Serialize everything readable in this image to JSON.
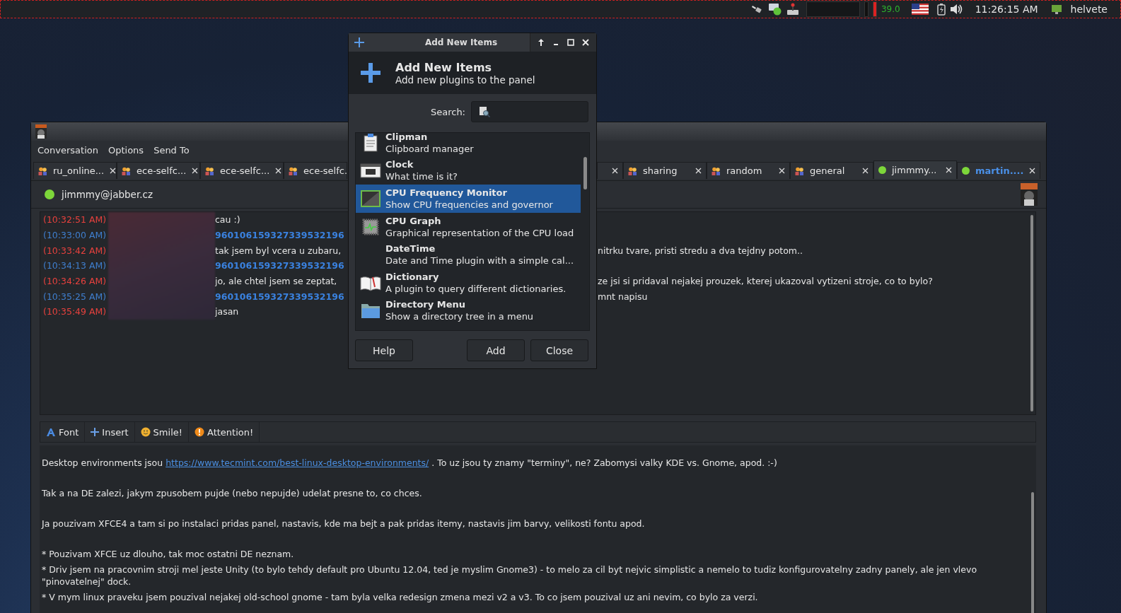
{
  "top_panel": {
    "cpu_reading": "39.0",
    "clock": "11:26:15 AM",
    "user": "helvete"
  },
  "chat_window": {
    "menu": [
      "Conversation",
      "Options",
      "Send To"
    ],
    "tabs_left": [
      {
        "kind": "group",
        "label": "ru_online...",
        "selected": false,
        "unread": false,
        "close": true
      },
      {
        "kind": "group",
        "label": "ece-selfc...",
        "selected": false,
        "unread": false,
        "close": true
      },
      {
        "kind": "group",
        "label": "ece-selfc...",
        "selected": false,
        "unread": false,
        "close": true
      },
      {
        "kind": "group",
        "label": "ece-selfc.",
        "selected": false,
        "unread": false
      }
    ],
    "tabs_right": [
      {
        "kind": "partial",
        "selected": false,
        "close": true
      },
      {
        "kind": "group",
        "label": "sharing",
        "selected": false,
        "unread": false,
        "close": true
      },
      {
        "kind": "group",
        "label": "random",
        "selected": false,
        "unread": false,
        "close": true
      },
      {
        "kind": "group",
        "label": "general",
        "selected": false,
        "unread": false,
        "close": true
      },
      {
        "kind": "contact",
        "label": "jimmmy...",
        "selected": true,
        "unread": false,
        "close": true
      },
      {
        "kind": "contact",
        "label": "martin....",
        "selected": false,
        "unread": true,
        "close": true
      }
    ],
    "contact": {
      "name": "jimmmy@jabber.cz",
      "online": true
    },
    "messages": [
      {
        "outgoing": false,
        "time": "(10:32:51 AM)",
        "text": "cau :)"
      },
      {
        "outgoing": true,
        "time": "(10:33:00 AM)",
        "text": "960106159327339532196"
      },
      {
        "outgoing": false,
        "time": "(10:33:42 AM)",
        "text": "tak jsem byl vcera u zubaru,",
        "text_right": "nitrku tvare, pristi stredu a dva tejdny potom.."
      },
      {
        "outgoing": true,
        "time": "(10:34:13 AM)",
        "text": "960106159327339532196"
      },
      {
        "outgoing": false,
        "time": "(10:34:26 AM)",
        "text": "jo, ale chtel jsem se zeptat,",
        "text_right": "ze jsi si pridaval nejakej prouzek, kterej ukazoval vytizeni stroje, co to bylo?"
      },
      {
        "outgoing": true,
        "time": "(10:35:25 AM)",
        "text": "960106159327339532196",
        "text_right": "mnt napisu"
      },
      {
        "outgoing": false,
        "time": "(10:35:49 AM)",
        "text": "jasan"
      }
    ],
    "toolbar": [
      "Font",
      "Insert",
      "Smile!",
      "Attention!"
    ],
    "input_paragraphs": [
      {
        "kind": "link",
        "before": "Desktop environments jsou",
        "link": "https://www.tecmint.com/best-linux-desktop-environments/",
        "after": ". To uz jsou ty znamy \"terminy\", ne? Zabomysi valky KDE vs. Gnome, apod. :-)"
      },
      {
        "kind": "paragraph",
        "text": "Tak a na DE zalezi, jakym zpusobem pujde (nebo nepujde) udelat presne to, co chces."
      },
      {
        "kind": "paragraph",
        "text": "Ja pouzivam XFCE4 a tam si po instalaci pridas panel, nastavis, kde ma bejt a pak pridas itemy, nastavis jim barvy, velikosti fontu apod."
      },
      {
        "kind": "bullet",
        "text": "* Pouzivam XFCE uz dlouho, tak moc ostatni DE neznam."
      },
      {
        "kind": "bullet",
        "text": "* Driv jsem na pracovnim stroji mel jeste Unity (to bylo tehdy default pro Ubuntu 12.04, ted je myslim Gnome3) - to melo za cil byt nejvic simplistic a nemelo to tudiz konfigurovatelny zadny panely, ale jen vlevo \"pinovatelnej\" dock."
      },
      {
        "kind": "bullet",
        "text": "* V mym linux praveku jsem pouzival nejakej old-school gnome - tam byla velka redesign zmena mezi v2 a v3. To co jsem pouzival uz ani nevim, co bylo za verzi."
      }
    ]
  },
  "dialog": {
    "title": "Add New Items",
    "heading": "Add New Items",
    "subtitle": "Add new plugins to the panel",
    "search_label": "Search:",
    "items": [
      {
        "title": "Clipman",
        "description": "Clipboard manager",
        "selected": false
      },
      {
        "title": "Clock",
        "description": "What time is it?",
        "selected": false
      },
      {
        "title": "CPU Frequency Monitor",
        "description": "Show CPU frequencies and governor",
        "selected": true
      },
      {
        "title": "CPU Graph",
        "description": "Graphical representation of the CPU load",
        "selected": false
      },
      {
        "title": "DateTime",
        "description": "Date and Time plugin with a simple cal...",
        "selected": false
      },
      {
        "title": "Dictionary",
        "description": "A plugin to query different dictionaries.",
        "selected": false
      },
      {
        "title": "Directory Menu",
        "description": "Show a directory tree in a menu",
        "selected": false
      }
    ],
    "buttons": [
      "Help",
      "Add",
      "Close"
    ]
  }
}
